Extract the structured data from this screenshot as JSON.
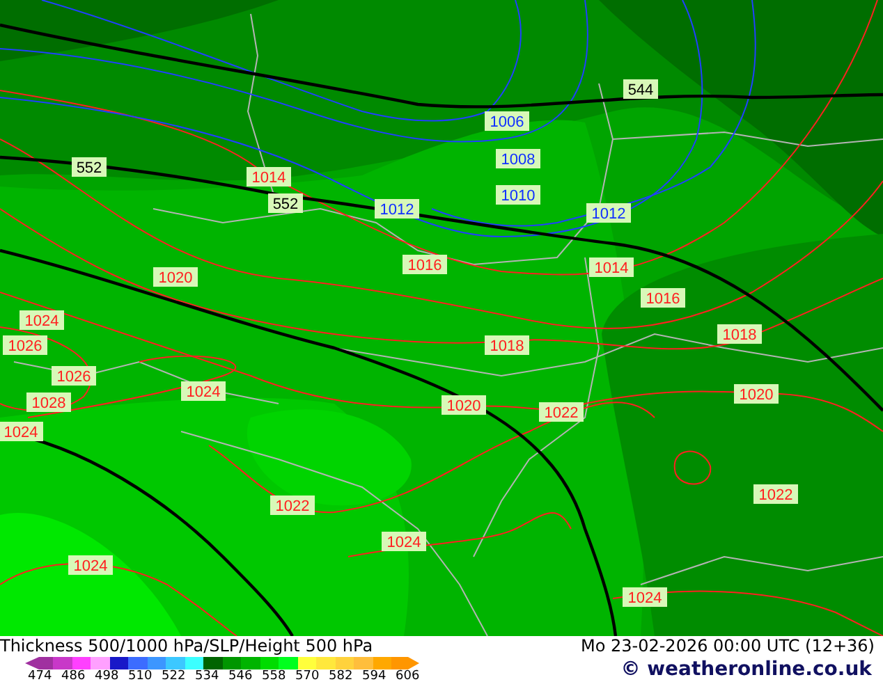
{
  "map": {
    "contour_labels": [
      {
        "text": "544",
        "kind": "height"
      },
      {
        "text": "552",
        "kind": "height"
      },
      {
        "text": "552",
        "kind": "height"
      },
      {
        "text": "1006",
        "kind": "isobar_low"
      },
      {
        "text": "1008",
        "kind": "isobar_low"
      },
      {
        "text": "1010",
        "kind": "isobar_low"
      },
      {
        "text": "1012",
        "kind": "isobar_low"
      },
      {
        "text": "1012",
        "kind": "isobar_low"
      },
      {
        "text": "1014",
        "kind": "isobar"
      },
      {
        "text": "1016",
        "kind": "isobar"
      },
      {
        "text": "1014",
        "kind": "isobar"
      },
      {
        "text": "1016",
        "kind": "isobar"
      },
      {
        "text": "1020",
        "kind": "isobar"
      },
      {
        "text": "1024",
        "kind": "isobar"
      },
      {
        "text": "1026",
        "kind": "isobar"
      },
      {
        "text": "1026",
        "kind": "isobar"
      },
      {
        "text": "1028",
        "kind": "isobar"
      },
      {
        "text": "1024",
        "kind": "isobar"
      },
      {
        "text": "1024",
        "kind": "isobar"
      },
      {
        "text": "1018",
        "kind": "isobar"
      },
      {
        "text": "1018",
        "kind": "isobar"
      },
      {
        "text": "1020",
        "kind": "isobar"
      },
      {
        "text": "1022",
        "kind": "isobar"
      },
      {
        "text": "1020",
        "kind": "isobar"
      },
      {
        "text": "1022",
        "kind": "isobar"
      },
      {
        "text": "1022",
        "kind": "isobar"
      },
      {
        "text": "1024",
        "kind": "isobar"
      },
      {
        "text": "1024",
        "kind": "isobar"
      },
      {
        "text": "1024",
        "kind": "isobar"
      }
    ]
  },
  "legend": {
    "title": "Thickness 500/1000 hPa/SLP/Height 500 hPa",
    "valid_time": "Mo 23-02-2026 00:00 UTC (12+36)",
    "credit": "© weatheronline.co.uk",
    "scale": [
      {
        "color": "#a030a0"
      },
      {
        "color": "#c838c8"
      },
      {
        "color": "#ff40ff"
      },
      {
        "color": "#ffa0ff"
      },
      {
        "color": "#1818c8"
      },
      {
        "color": "#3c6cff"
      },
      {
        "color": "#3c96ff"
      },
      {
        "color": "#3cc8ff"
      },
      {
        "color": "#3cffff"
      },
      {
        "color": "#006400"
      },
      {
        "color": "#009600"
      },
      {
        "color": "#00b400"
      },
      {
        "color": "#00dc00"
      },
      {
        "color": "#00ff1e"
      },
      {
        "color": "#ffff3c"
      },
      {
        "color": "#ffe83c"
      },
      {
        "color": "#ffd23c"
      },
      {
        "color": "#ffbe3c"
      },
      {
        "color": "#ffa800"
      },
      {
        "color": "#ff9600"
      }
    ],
    "ticks": [
      "474",
      "486",
      "498",
      "510",
      "522",
      "534",
      "546",
      "558",
      "570",
      "582",
      "594",
      "606"
    ]
  }
}
